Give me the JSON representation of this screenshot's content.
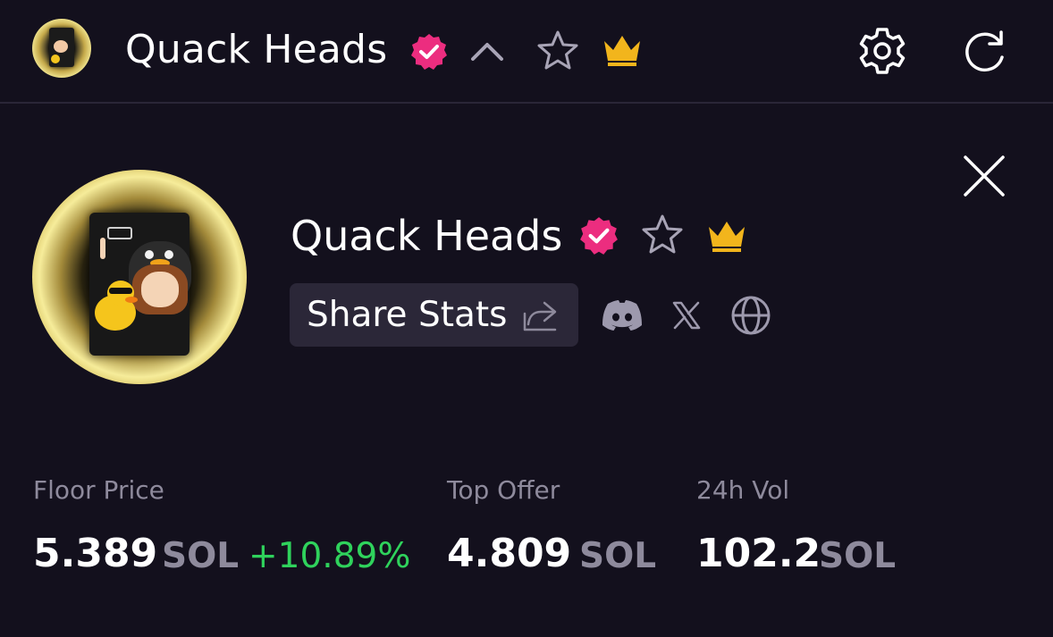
{
  "header": {
    "collection_name": "Quack Heads",
    "icons": {
      "verified": "verified-badge-icon",
      "collapse": "chevron-up-icon",
      "favorite": "star-icon",
      "premium": "crown-icon",
      "settings": "gear-icon",
      "refresh": "refresh-icon"
    }
  },
  "panel": {
    "collection_name": "Quack Heads",
    "share_label": "Share Stats",
    "socials": [
      "discord-icon",
      "x-icon",
      "globe-icon"
    ],
    "close": "close-icon"
  },
  "stats": {
    "floor": {
      "label": "Floor Price",
      "value": "5.389",
      "unit": "SOL",
      "change": "+10.89%"
    },
    "top_offer": {
      "label": "Top Offer",
      "value": "4.809",
      "unit": "SOL"
    },
    "volume": {
      "label": "24h Vol",
      "value": "102.2",
      "unit": "SOL"
    }
  },
  "colors": {
    "background": "#13101d",
    "verified_pink": "#ec2d7f",
    "crown_gold": "#f2b51c",
    "positive_green": "#2fd25c",
    "muted_text": "#8e8a9c",
    "button_bg": "#2b2738"
  }
}
